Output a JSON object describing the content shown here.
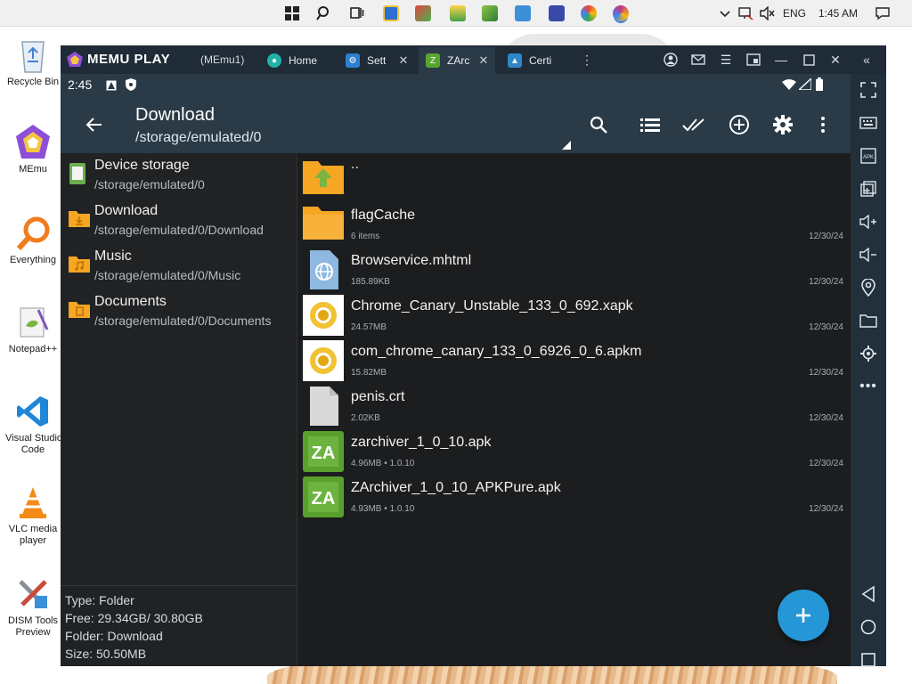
{
  "taskbar": {
    "tray": {
      "language": "ENG",
      "time": "1:45 AM"
    }
  },
  "desktop": {
    "icons": [
      {
        "label": "Recycle Bin"
      },
      {
        "label": "MEmu"
      },
      {
        "label": "Everything"
      },
      {
        "label": "Notepad++"
      },
      {
        "label": "Visual Studio Code",
        "label2": "Code",
        "label1": "Visual Studio"
      },
      {
        "label1": "VLC media",
        "label2": "player"
      },
      {
        "label1": "DISM Tools",
        "label2": "Preview"
      }
    ]
  },
  "memu": {
    "brand": "MEMU PLAY",
    "instance": "(MEmu1)",
    "tabs": [
      {
        "label": "Home",
        "icon": "home-icon"
      },
      {
        "label": "Sett",
        "icon": "settings-icon"
      },
      {
        "label": "ZArc",
        "icon": "zarchiver-icon"
      },
      {
        "label": "Certi",
        "icon": "certificate-icon"
      }
    ]
  },
  "android": {
    "status_time": "2:45",
    "appbar": {
      "title": "Download",
      "path": "/storage/emulated/0"
    },
    "locations": [
      {
        "name": "Device storage",
        "path": "/storage/emulated/0",
        "icon": "device-storage-icon"
      },
      {
        "name": "Download",
        "path": "/storage/emulated/0/Download",
        "icon": "download-folder-icon"
      },
      {
        "name": "Music",
        "path": "/storage/emulated/0/Music",
        "icon": "music-folder-icon"
      },
      {
        "name": "Documents",
        "path": "/storage/emulated/0/Documents",
        "icon": "documents-folder-icon"
      }
    ],
    "info": {
      "type": "Type: Folder",
      "free": "Free: 29.34GB/ 30.80GB",
      "folder": "Folder: Download",
      "size": "Size: 50.50MB"
    },
    "files": [
      {
        "name": "..",
        "meta": "",
        "date": "",
        "icon": "parent-folder-icon"
      },
      {
        "name": "flagCache",
        "meta": "6 items",
        "date": "12/30/24",
        "icon": "folder-icon"
      },
      {
        "name": "Browservice.mhtml",
        "meta": "185.89KB",
        "date": "12/30/24",
        "icon": "web-file-icon"
      },
      {
        "name": "Chrome_Canary_Unstable_133_0_692.xapk",
        "meta": "24.57MB",
        "date": "12/30/24",
        "icon": "chrome-canary-icon"
      },
      {
        "name": "com_chrome_canary_133_0_6926_0_6.apkm",
        "meta": "15.82MB",
        "date": "12/30/24",
        "icon": "chrome-canary-icon"
      },
      {
        "name": "penis.crt",
        "meta": "2.02KB",
        "date": "12/30/24",
        "icon": "file-icon"
      },
      {
        "name": "zarchiver_1_0_10.apk",
        "meta": "4.96MB  •  1.0.10",
        "date": "12/30/24",
        "icon": "zarchiver-icon"
      },
      {
        "name": "ZArchiver_1_0_10_APKPure.apk",
        "meta": "4.93MB  •  1.0.10",
        "date": "12/30/24",
        "icon": "zarchiver-icon"
      }
    ]
  }
}
